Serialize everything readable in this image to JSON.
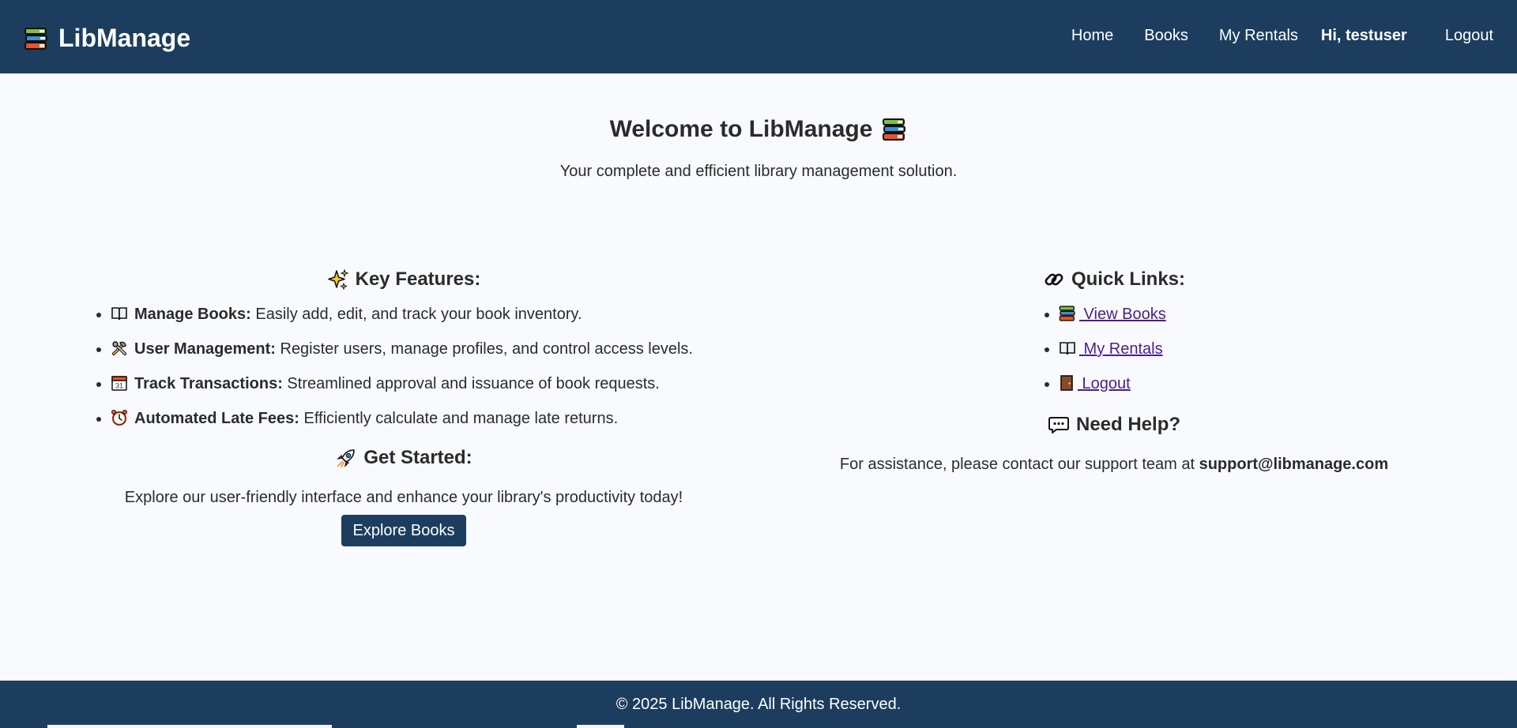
{
  "header": {
    "brand": "LibManage",
    "brand_icon": "books-icon",
    "nav": {
      "home": "Home",
      "books": "Books",
      "rentals": "My Rentals",
      "greeting": "Hi, testuser",
      "logout": "Logout"
    }
  },
  "hero": {
    "title": "Welcome to LibManage",
    "title_icon": "books-icon",
    "tagline": "Your complete and efficient library management solution."
  },
  "features": {
    "title": "Key Features:",
    "title_icon": "sparkles-icon",
    "items": [
      {
        "icon": "open-book-icon",
        "label": "Manage Books:",
        "text": " Easily add, edit, and track your book inventory."
      },
      {
        "icon": "tools-icon",
        "label": "User Management:",
        "text": " Register users, manage profiles, and control access levels."
      },
      {
        "icon": "calendar-icon",
        "label": "Track Transactions:",
        "text": " Streamlined approval and issuance of book requests."
      },
      {
        "icon": "alarm-clock-icon",
        "label": "Automated Late Fees:",
        "text": " Efficiently calculate and manage late returns."
      }
    ]
  },
  "get_started": {
    "title": "Get Started:",
    "title_icon": "rocket-icon",
    "text": "Explore our user-friendly interface and enhance your library's productivity today!",
    "button": "Explore Books"
  },
  "quick_links": {
    "title": "Quick Links:",
    "title_icon": "link-icon",
    "items": [
      {
        "icon": "books-icon",
        "label": " View Books"
      },
      {
        "icon": "open-book-icon",
        "label": " My Rentals"
      },
      {
        "icon": "door-icon",
        "label": " Logout"
      }
    ]
  },
  "help": {
    "title": "Need Help?",
    "title_icon": "speech-bubble-icon",
    "text": "For assistance, please contact our support team at ",
    "email": "support@libmanage.com"
  },
  "footer": {
    "text": "© 2025 LibManage. All Rights Reserved."
  },
  "colors": {
    "primary": "#1c3d5e",
    "background": "#f8fafd",
    "link": "#4a1f8a"
  }
}
